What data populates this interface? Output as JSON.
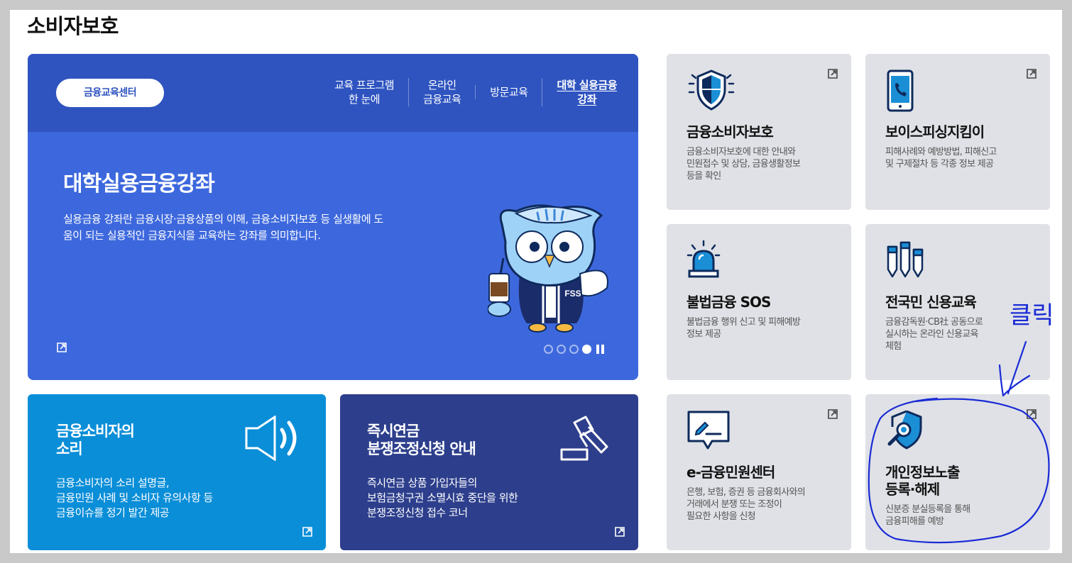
{
  "page": {
    "title": "소비자보호"
  },
  "hero": {
    "pill_label": "금융교육센터",
    "tabs": [
      {
        "label": "교육 프로그램\n한 눈에",
        "active": false
      },
      {
        "label": "온라인\n금융교육",
        "active": false
      },
      {
        "label": "방문교육",
        "active": false
      },
      {
        "label": "대학 실용금융\n강좌",
        "active": true
      }
    ],
    "heading": "대학실용금융강좌",
    "description": "실용금융 강좌란 금융시장·금융상품의 이해, 금융소비자보호 등 실생활에 도움이 되는 실용적인 금융지식을 교육하는 강좌를 의미합니다.",
    "mascot_label": "FSS",
    "carousel": {
      "count": 4,
      "active": 4
    }
  },
  "cards": [
    {
      "title": "금융소비자의\n소리",
      "description": "금융소비자의 소리 설명글,\n금융민원 사례 및 소비자 유의사항 등\n금융이슈를 정기 발간 제공",
      "icon": "speaker-icon"
    },
    {
      "title": "즉시연금\n분쟁조정신청 안내",
      "description": "즉시연금 상품 가입자들의\n보험금청구권 소멸시효 중단을 위한\n분쟁조정신청 접수 코너",
      "icon": "gavel-icon"
    }
  ],
  "tiles": [
    {
      "title": "금융소비자보호",
      "description": "금융소비자보호에 대한 안내와\n민원접수 및 상담, 금융생활정보\n등을 확인",
      "icon": "shield-icon"
    },
    {
      "title": "보이스피싱지킴이",
      "description": "피해사례와 예방방법, 피해신고\n및 구제절차 등 각종 정보 제공",
      "icon": "phone-icon"
    },
    {
      "title": "불법금융 SOS",
      "description": "불법금융 행위 신고 및 피해예방\n정보 제공",
      "icon": "siren-icon"
    },
    {
      "title": "전국민 신용교육",
      "description": "금융감독원·CB社 공동으로\n실시하는 온라인 신용교육\n체험",
      "icon": "pencils-icon"
    },
    {
      "title": "e-금융민원센터",
      "description": "은행, 보험, 증권 등 금융회사와의\n거래에서 분쟁 또는 조정이\n필요한 사항을 신청",
      "icon": "chat-edit-icon"
    },
    {
      "title": "개인정보노출\n등록·해제",
      "description": "신분증 분실등록을 통해\n금융피해를 예방",
      "icon": "shield-search-icon"
    }
  ],
  "annotation": {
    "handwritten_text": "클릭",
    "color": "#1a2bd6"
  },
  "colors": {
    "hero_bg": "#3d68dd",
    "hero_top": "#2f54c0",
    "card1_bg": "#0a8ed8",
    "card2_bg": "#2d3f8c",
    "tile_bg": "#dfe1e6",
    "icon_navy": "#0e2a5c",
    "icon_accent": "#1a8fd6"
  }
}
